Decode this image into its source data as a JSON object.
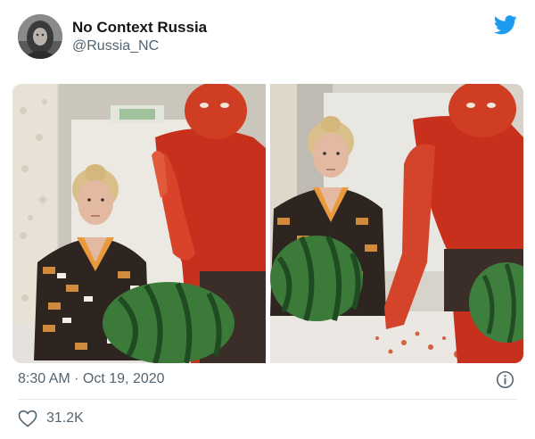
{
  "tweet": {
    "display_name": "No Context Russia",
    "handle": "@Russia_NC",
    "timestamp": "8:30 AM · Oct 19, 2020",
    "like_count": "31.2K"
  },
  "icons": {
    "brand": "twitter-bird-icon",
    "info": "info-icon",
    "like": "heart-icon"
  },
  "colors": {
    "twitter_blue": "#1d9bf0",
    "secondary_text": "#536471",
    "divider": "#e1e8ed"
  }
}
